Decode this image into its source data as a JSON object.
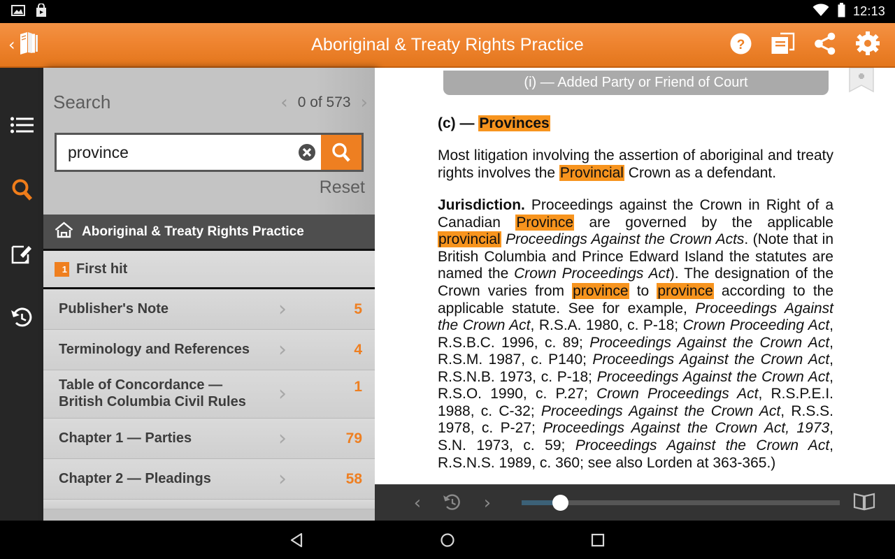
{
  "status_bar": {
    "time": "12:13",
    "icons": [
      "image-icon",
      "shopping-bag-icon",
      "wifi-icon",
      "battery-icon"
    ]
  },
  "app_bar": {
    "title": "Aboriginal & Treaty Rights Practice",
    "back_icon": "back-books-icon",
    "actions": [
      {
        "name": "help-icon",
        "label": "?"
      },
      {
        "name": "library-icon",
        "label": ""
      },
      {
        "name": "share-icon",
        "label": ""
      },
      {
        "name": "settings-gear-icon",
        "label": ""
      }
    ]
  },
  "rail": {
    "items": [
      {
        "name": "toc-list-icon",
        "active": false
      },
      {
        "name": "search-icon",
        "active": true
      },
      {
        "name": "annotations-icon",
        "active": false
      },
      {
        "name": "history-icon",
        "active": false
      }
    ]
  },
  "search_panel": {
    "label": "Search",
    "hit_counter": "0 of 573",
    "prev_icon": "chevron-left-icon",
    "next_icon": "chevron-right-icon",
    "input_value": "province",
    "input_placeholder": "Search",
    "clear_icon": "clear-circle-icon",
    "go_icon": "search-icon",
    "reset_label": "Reset",
    "book_title": "Aboriginal & Treaty Rights Practice",
    "home_icon": "home-icon",
    "first_hit_label": "First hit",
    "first_hit_badge": "1"
  },
  "toc": {
    "rows": [
      {
        "title": "Publisher's Note",
        "count": "5"
      },
      {
        "title": "Terminology and References",
        "count": "4"
      },
      {
        "title": "Table of Concordance — British Columbia Civil Rules",
        "count": "1"
      },
      {
        "title": "Chapter 1 — Parties",
        "count": "79"
      },
      {
        "title": "Chapter 2 — Pleadings",
        "count": "58"
      }
    ],
    "arrow_icon": "chevron-right-icon"
  },
  "document": {
    "section_header": "(i) — Added Party or Friend of Court",
    "bookmark_icon": "add-bookmark-icon",
    "heading_prefix": "(c) — ",
    "heading_highlight": "Provinces",
    "paragraph_1": {
      "part_a": "Most litigation involving the assertion of aboriginal and treaty rights involves the ",
      "hl_1": "Provincial",
      "part_b": " Crown as a defendant."
    },
    "paragraph_2": {
      "lead": "Jurisdiction.",
      "t1": " Proceedings against the Crown in Right of a Canadian ",
      "hl_1": "Province",
      "t2": " are governed by the applicable ",
      "hl_2": "provincial",
      "t3": " ",
      "it_1": "Proceedings Against the Crown Acts",
      "t4": ". (Note that in British Columbia and Prince Edward Island the statutes are named the ",
      "it_2": "Crown Proceedings Act",
      "t5": "). The designation of the Crown varies from ",
      "hl_3": "province",
      "t6": " to ",
      "hl_4": "province",
      "t7": " according to the applicable statute. See for example, ",
      "it_3": "Proceedings Against the Crown Act",
      "t8": ", R.S.A. 1980, c. P-18; ",
      "it_4": "Crown Proceeding Act",
      "t9": ", R.S.B.C. 1996, c. 89; ",
      "it_5": "Proceedings Against the Crown Act",
      "t10": ", R.S.M. 1987, c. P140; ",
      "it_6": "Proceedings Against the Crown Act",
      "t11": ", R.S.N.B. 1973, c. P-18; ",
      "it_7": "Proceedings Against the Crown Act",
      "t12": ", R.S.O. 1990, c. P.27; ",
      "it_8": "Crown Proceedings Act",
      "t13": ", R.S.P.E.I. 1988, c. C-32; ",
      "it_9": "Proceedings Against the Crown Act",
      "t14": ", R.S.S. 1978, c. P-27; ",
      "it_10": "Proceedings Against the Crown Act, 1973",
      "t15": ", S.N. 1973, c. 59; ",
      "it_11": "Proceedings Against the Crown Act",
      "t16": ", R.S.N.S. 1989, c. 360; see also Lorden at 363-365.)"
    }
  },
  "reader_bar": {
    "prev_icon": "chevron-left-icon",
    "history_icon": "history-icon",
    "next_icon": "chevron-right-icon",
    "slider_position_percent": 10,
    "view_mode_icon": "open-book-icon"
  },
  "nav_bar": {
    "back_icon": "android-back-icon",
    "home_icon": "android-home-icon",
    "recents_icon": "android-recents-icon"
  },
  "colors": {
    "accent_orange": "#ee7f21",
    "highlight_orange": "#f7941e",
    "appbar_top": "#f39244",
    "appbar_bottom": "#e3761c",
    "rail_dark": "#262626",
    "drawer_gray": "#c3c3c3",
    "toc_row": "#d4d4d4",
    "readerbar_dark": "#333333",
    "slider_fill": "#3c6177"
  }
}
